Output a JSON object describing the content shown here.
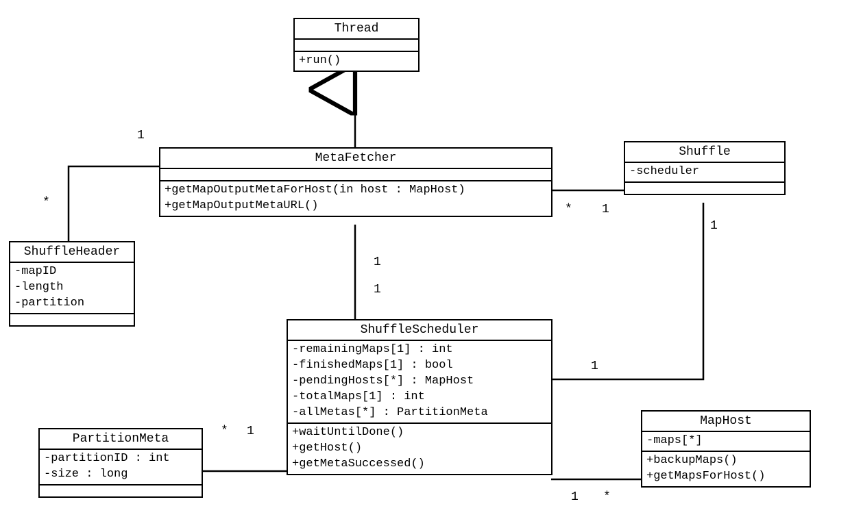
{
  "classes": {
    "thread": {
      "name": "Thread",
      "attrs": [],
      "ops": [
        "+run()"
      ]
    },
    "metaFetcher": {
      "name": "MetaFetcher",
      "attrs": [],
      "ops": [
        "+getMapOutputMetaForHost(in host : MapHost)",
        "+getMapOutputMetaURL()"
      ]
    },
    "shuffle": {
      "name": "Shuffle",
      "attrs": [
        "-scheduler"
      ],
      "ops": []
    },
    "shuffleHeader": {
      "name": "ShuffleHeader",
      "attrs": [
        "-mapID",
        "-length",
        "-partition"
      ],
      "ops": []
    },
    "shuffleScheduler": {
      "name": "ShuffleScheduler",
      "attrs": [
        "-remainingMaps[1] : int",
        "-finishedMaps[1] : bool",
        "-pendingHosts[*] : MapHost",
        "-totalMaps[1] : int",
        "-allMetas[*] : PartitionMeta"
      ],
      "ops": [
        "+waitUntilDone()",
        "+getHost()",
        "+getMetaSuccessed()"
      ]
    },
    "partitionMeta": {
      "name": "PartitionMeta",
      "attrs": [
        "-partitionID : int",
        "-size : long"
      ],
      "ops": []
    },
    "mapHost": {
      "name": "MapHost",
      "attrs": [
        "-maps[*]"
      ],
      "ops": [
        "+backupMaps()",
        "+getMapsForHost()"
      ]
    }
  },
  "mults": {
    "mf_sh_1": "1",
    "mf_sh_star": "*",
    "mf_shuffle_star": "*",
    "mf_shuffle_1": "1",
    "shuffle_ss_1a": "1",
    "shuffle_ss_1b": "1",
    "mf_ss_1a": "1",
    "mf_ss_1b": "1",
    "ss_pm_1": "1",
    "ss_pm_star": "*",
    "ss_mh_1": "1",
    "ss_mh_star": "*"
  }
}
